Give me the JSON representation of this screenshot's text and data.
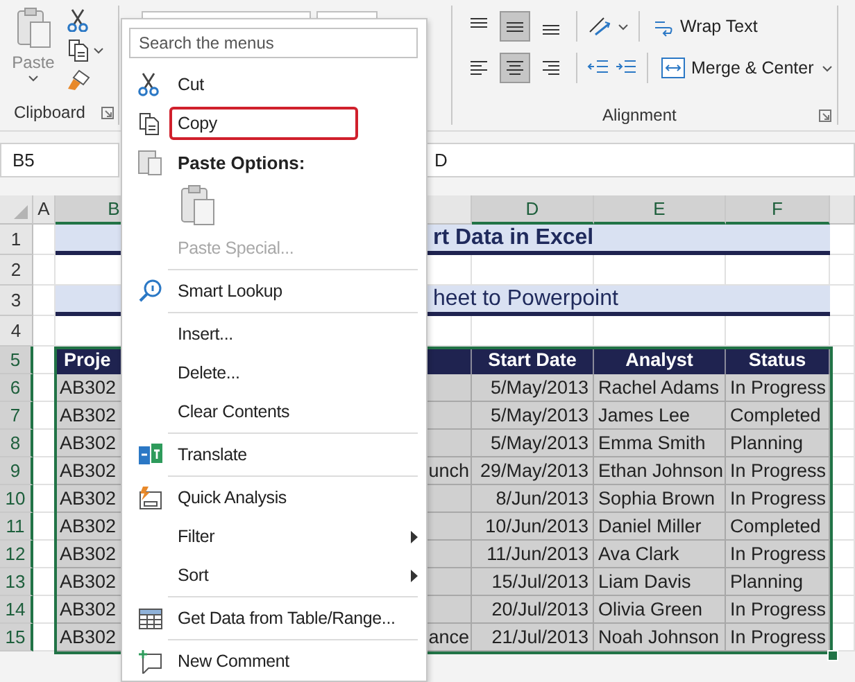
{
  "ribbon": {
    "clipboard": {
      "paste_label": "Paste",
      "group_label": "Clipboard"
    },
    "alignment": {
      "vertical": [
        {
          "selected": false
        },
        {
          "selected": true
        },
        {
          "selected": false
        }
      ],
      "horizontal": [
        {
          "selected": false
        },
        {
          "selected": true
        },
        {
          "selected": false
        }
      ],
      "wrap_text": "Wrap Text",
      "merge": "Merge & Center",
      "group_label": "Alignment"
    }
  },
  "formula_bar": {
    "name_box": "B5",
    "value": "D"
  },
  "sheet": {
    "column_headers": [
      {
        "label": "A",
        "selected": false
      },
      {
        "label": "B",
        "selected": true
      },
      {
        "label": "D",
        "selected": true
      },
      {
        "label": "E",
        "selected": true
      },
      {
        "label": "F",
        "selected": true
      }
    ],
    "rows": [
      {
        "row": "1",
        "selected": false,
        "kind": "title",
        "text": "rt Data in Excel"
      },
      {
        "row": "2",
        "selected": false,
        "kind": "blank"
      },
      {
        "row": "3",
        "selected": false,
        "kind": "subtitle",
        "text": "heet to Powerpoint"
      },
      {
        "row": "4",
        "selected": false,
        "kind": "blank"
      },
      {
        "row": "5",
        "selected": true,
        "kind": "header",
        "cells": {
          "project": "Proje",
          "start_date": "Start Date",
          "analyst": "Analyst",
          "status": "Status"
        }
      },
      {
        "row": "6",
        "selected": true,
        "kind": "data",
        "cells": {
          "project": "AB302",
          "start_date": "5/May/2013",
          "analyst": "Rachel Adams",
          "status": "In Progress"
        }
      },
      {
        "row": "7",
        "selected": true,
        "kind": "data",
        "cells": {
          "project": "AB302",
          "start_date": "5/May/2013",
          "analyst": "James Lee",
          "status": "Completed"
        }
      },
      {
        "row": "8",
        "selected": true,
        "kind": "data",
        "cells": {
          "project": "AB302",
          "start_date": "5/May/2013",
          "analyst": "Emma Smith",
          "status": "Planning"
        }
      },
      {
        "row": "9",
        "selected": true,
        "kind": "data",
        "cells": {
          "project": "AB302",
          "column_c": "unch",
          "start_date": "29/May/2013",
          "analyst": "Ethan Johnson",
          "status": "In Progress"
        }
      },
      {
        "row": "10",
        "selected": true,
        "kind": "data",
        "cells": {
          "project": "AB302",
          "start_date": "8/Jun/2013",
          "analyst": "Sophia Brown",
          "status": "In Progress"
        }
      },
      {
        "row": "11",
        "selected": true,
        "kind": "data",
        "cells": {
          "project": "AB302",
          "start_date": "10/Jun/2013",
          "analyst": "Daniel Miller",
          "status": "Completed"
        }
      },
      {
        "row": "12",
        "selected": true,
        "kind": "data",
        "cells": {
          "project": "AB302",
          "start_date": "11/Jun/2013",
          "analyst": "Ava Clark",
          "status": "In Progress"
        }
      },
      {
        "row": "13",
        "selected": true,
        "kind": "data",
        "cells": {
          "project": "AB302",
          "start_date": "15/Jul/2013",
          "analyst": "Liam Davis",
          "status": "Planning"
        }
      },
      {
        "row": "14",
        "selected": true,
        "kind": "data",
        "cells": {
          "project": "AB302",
          "start_date": "20/Jul/2013",
          "analyst": "Olivia Green",
          "status": "In Progress"
        }
      },
      {
        "row": "15",
        "selected": true,
        "kind": "data",
        "cells": {
          "project": "AB302",
          "column_c": "ance",
          "start_date": "21/Jul/2013",
          "analyst": "Noah Johnson",
          "status": "In Progress"
        }
      }
    ]
  },
  "context_menu": {
    "search": {
      "placeholder": "Search the menus"
    },
    "items": [
      {
        "kind": "item",
        "label": "Cut",
        "disabled": false,
        "highlighted": false,
        "submenu": false
      },
      {
        "kind": "item",
        "label": "Copy",
        "disabled": false,
        "highlighted": true,
        "submenu": false
      },
      {
        "kind": "heading",
        "label": "Paste Options:"
      },
      {
        "kind": "paste-icons"
      },
      {
        "kind": "item",
        "label": "Paste Special...",
        "disabled": true,
        "highlighted": false,
        "submenu": false
      },
      {
        "kind": "separator"
      },
      {
        "kind": "item",
        "label": "Smart Lookup",
        "disabled": false,
        "highlighted": false,
        "submenu": false
      },
      {
        "kind": "separator"
      },
      {
        "kind": "item",
        "label": "Insert...",
        "disabled": false,
        "highlighted": false,
        "submenu": false
      },
      {
        "kind": "item",
        "label": "Delete...",
        "disabled": false,
        "highlighted": false,
        "submenu": false
      },
      {
        "kind": "item",
        "label": "Clear Contents",
        "disabled": false,
        "highlighted": false,
        "submenu": false
      },
      {
        "kind": "separator"
      },
      {
        "kind": "item",
        "label": "Translate",
        "disabled": false,
        "highlighted": false,
        "submenu": false
      },
      {
        "kind": "separator"
      },
      {
        "kind": "item",
        "label": "Quick Analysis",
        "disabled": false,
        "highlighted": false,
        "submenu": false
      },
      {
        "kind": "item",
        "label": "Filter",
        "disabled": false,
        "highlighted": false,
        "submenu": true
      },
      {
        "kind": "item",
        "label": "Sort",
        "disabled": false,
        "highlighted": false,
        "submenu": true
      },
      {
        "kind": "separator"
      },
      {
        "kind": "item",
        "label": "Get Data from Table/Range...",
        "disabled": false,
        "highlighted": false,
        "submenu": false
      },
      {
        "kind": "separator"
      },
      {
        "kind": "item",
        "label": "New Comment",
        "disabled": false,
        "highlighted": false,
        "submenu": false
      }
    ]
  }
}
